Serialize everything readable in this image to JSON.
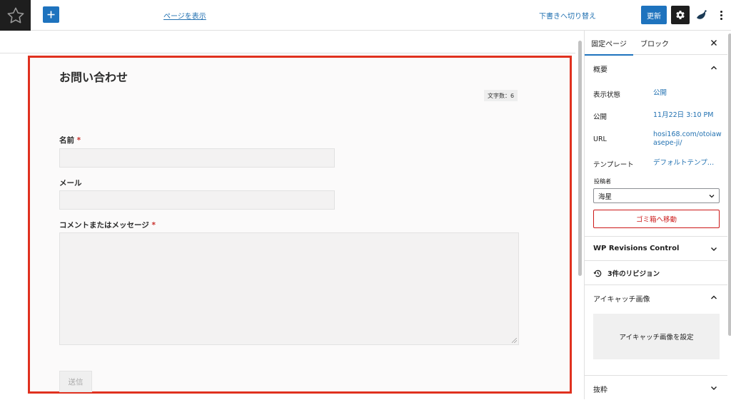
{
  "topbar": {
    "view_page_label": "ページを表示",
    "switch_to_draft_label": "下書きへ切り替え",
    "update_label": "更新"
  },
  "form": {
    "page_title": "お問い合わせ",
    "char_count": "文字数：6",
    "name_label": "名前",
    "email_label": "メール",
    "message_label": "コメントまたはメッセージ",
    "required_mark": "*",
    "submit_label": "送信"
  },
  "sidebar": {
    "tabs": [
      {
        "label": "固定ページ",
        "active": true
      },
      {
        "label": "ブロック",
        "active": false
      }
    ],
    "summary": {
      "title": "概要",
      "visibility_label": "表示状態",
      "visibility_value": "公開",
      "publish_label": "公開",
      "publish_value": "11月22日 3:10 PM",
      "url_label": "URL",
      "url_value_1": "hosi168.com/otoiaw",
      "url_value_2": "asepe-ji/",
      "template_label": "テンプレート",
      "template_value": "デフォルトテンプ…",
      "author_label": "投稿者",
      "author_value": "海星",
      "trash_label": "ゴミ箱へ移動"
    },
    "revisions_control_title": "WP Revisions Control",
    "revisions_label": "3件のリビジョン",
    "featured_image_title": "アイキャッチ画像",
    "featured_image_button": "アイキャッチ画像を設定",
    "excerpt_title": "抜粋"
  },
  "colors": {
    "accent": "#1e73be",
    "highlight_border": "#e0311f",
    "danger": "#cc1818",
    "link": "#2271b1"
  },
  "icons": [
    "star-icon",
    "plus-icon",
    "gear-icon",
    "plugin-logo-icon",
    "more-vertical-icon",
    "close-icon",
    "chevron-up-icon",
    "chevron-down-icon",
    "history-icon"
  ]
}
